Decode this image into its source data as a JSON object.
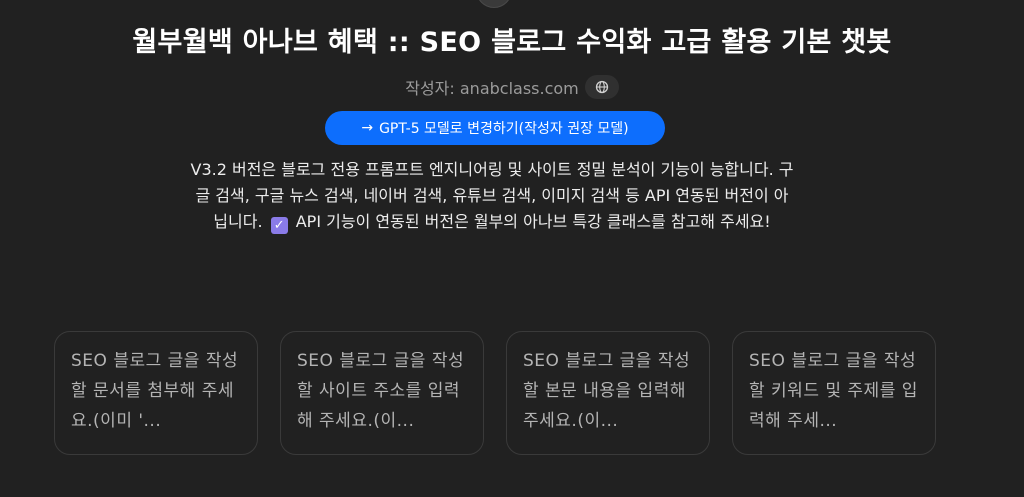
{
  "header": {
    "title": "월부월백 아나브 혜택 :: SEO 블로그 수익화 고급 활용 기본 챗봇",
    "author_label": "작성자: anabclass.com"
  },
  "cta": {
    "arrow": "→",
    "label": "GPT-5 모델로 변경하기(작성자 권장 모델)"
  },
  "description": {
    "part1": "V3.2 버전은 블로그 전용 프롬프트 엔지니어링 및 사이트 정밀 분석이 기능이 능합니다. 구글 검색, 구글 뉴스 검색, 네이버 검색, 유튜브 검색, 이미지 검색 등 API 연동된 버전이 아닙니다.",
    "check": "✓",
    "part2": "API 기능이 연동된 버전은 월부의 아나브 특강 클래스를 참고해 주세요!"
  },
  "starters": [
    {
      "label": "SEO 블로그 글을 작성할 문서를 첨부해 주세요.(이미 '..."
    },
    {
      "label": "SEO 블로그 글을 작성할 사이트 주소를 입력해 주세요.(이..."
    },
    {
      "label": "SEO 블로그 글을 작성할 본문 내용을 입력해 주세요.(이..."
    },
    {
      "label": "SEO 블로그 글을 작성할 키워드 및 주제를 입력해 주세..."
    }
  ]
}
